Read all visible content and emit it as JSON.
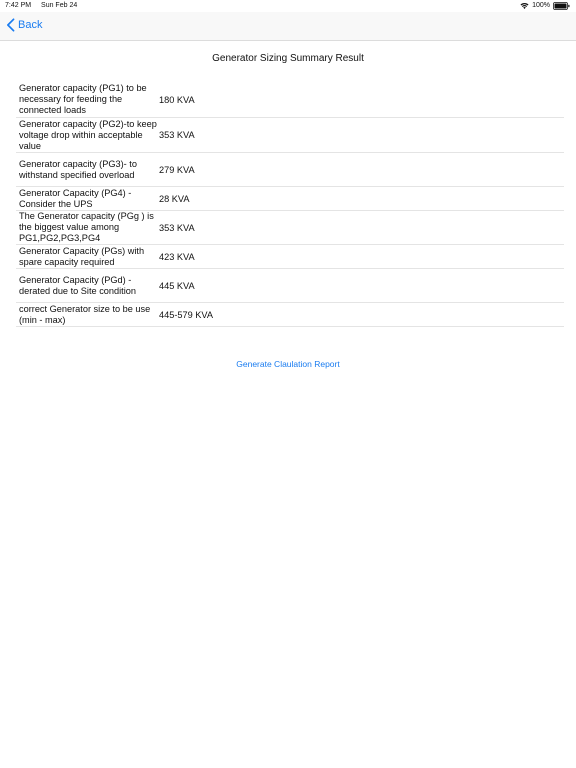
{
  "status": {
    "time": "7:42 PM",
    "date": "Sun Feb 24",
    "battery": "100%"
  },
  "nav": {
    "back_label": "Back",
    "back_icon": "chevron-left-icon"
  },
  "page": {
    "title": "Generator Sizing Summary Result"
  },
  "rows": [
    {
      "label": "Generator capacity (PG1)  to be necessary for feeding the connected loads",
      "value": "180 KVA"
    },
    {
      "label": "Generator capacity (PG2)-to keep voltage drop within acceptable value",
      "value": "353 KVA"
    },
    {
      "label": "Generator capacity (PG3)- to withstand specified overload",
      "value": "279 KVA"
    },
    {
      "label": "Generator Capacity (PG4) - Consider the UPS",
      "value": "28 KVA"
    },
    {
      "label": "The Generator capacity (PGg ) is the biggest value among PG1,PG2,PG3,PG4",
      "value": "353 KVA"
    },
    {
      "label": "Generator Capacity (PGs) with spare capacity required",
      "value": "423 KVA"
    },
    {
      "label": "Generator Capacity (PGd) - derated due to Site condition",
      "value": "445 KVA"
    },
    {
      "label": "correct Generator size to be use (min - max)",
      "value": "445-579 KVA"
    }
  ],
  "actions": {
    "report_label": "Generate Claulation Report"
  },
  "colors": {
    "accent": "#1a7cf0",
    "divider": "#e4e4e4"
  }
}
